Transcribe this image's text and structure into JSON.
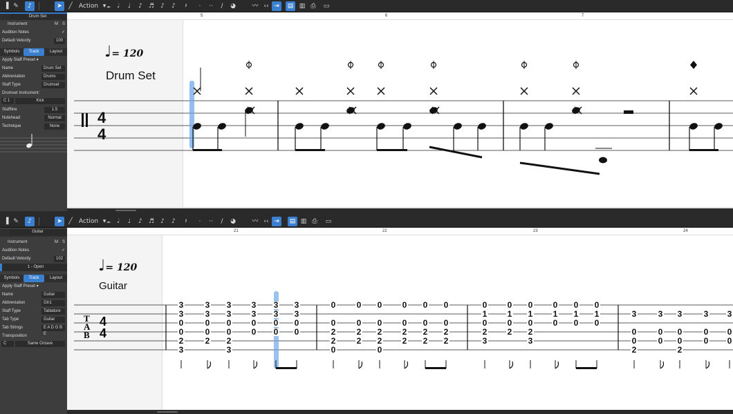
{
  "drum": {
    "toolbar": {
      "action_label": "Action",
      "selected_tool": "pointer-tool"
    },
    "inspector": {
      "track_name": "Drum Set",
      "instrument_label": "Instrument",
      "m_label": "M",
      "s_label": "S",
      "audition_label": "Audition Notes",
      "velocity_label": "Default Velocity",
      "velocity_value": "100",
      "tabs": [
        "Symbols",
        "Track",
        "Layout"
      ],
      "active_tab": "Track",
      "preset_label": "Apply Staff Preset",
      "fields": [
        [
          "Name",
          "Drum Set"
        ],
        [
          "Abbreviation",
          "Drums"
        ],
        [
          "Staff Type",
          "Drumset"
        ]
      ],
      "drumset_instrument_label": "Drumset Instrument:",
      "pitch_value": "C 1",
      "kit_value": "Kick",
      "fields2": [
        [
          "Staffline",
          "1.5"
        ],
        [
          "Notehead",
          "Normal"
        ],
        [
          "Technique",
          "None"
        ]
      ]
    },
    "score": {
      "tempo": "= 120",
      "track_title": "Drum Set",
      "measures": [
        "5",
        "6",
        "7"
      ]
    }
  },
  "guitar": {
    "toolbar": {
      "action_label": "Action",
      "selected_tool": "pointer-tool"
    },
    "inspector": {
      "track_name": "Guitar",
      "instrument_label": "Instrument",
      "m_label": "M",
      "s_label": "S",
      "audition_label": "Audition Notes",
      "velocity_label": "Default Velocity",
      "velocity_value": "102",
      "tuning_value": "1 - Open",
      "tabs": [
        "Symbols",
        "Track",
        "Layout"
      ],
      "active_tab": "Track",
      "preset_label": "Apply Staff Preset",
      "fields": [
        [
          "Name",
          "Guitar"
        ],
        [
          "Abbreviation",
          "Gtr1"
        ],
        [
          "Staff Type",
          "Tablature"
        ],
        [
          "Tab Type",
          "Guitar"
        ],
        [
          "Tab Strings",
          "E A D G B E"
        ]
      ],
      "transposition_label": "Transposition",
      "transpose_key": "C",
      "transpose_octave": "Same Octave"
    },
    "score": {
      "tempo": "= 120",
      "track_title": "Guitar",
      "measures": [
        "21",
        "22",
        "23",
        "24"
      ],
      "clef": [
        "T",
        "A",
        "B"
      ],
      "time_sig": [
        "4",
        "4"
      ],
      "chords": [
        [
          "3",
          "3",
          "0",
          "0",
          "2",
          "3"
        ],
        [
          "3",
          "3",
          "0",
          "0",
          "2",
          ""
        ],
        [
          "3",
          "3",
          "0",
          "0",
          "2",
          "3"
        ],
        [
          "3",
          "3",
          "0",
          "0",
          "",
          ""
        ],
        [
          "3",
          "3",
          "0",
          "0",
          "",
          ""
        ],
        [
          "3",
          "3",
          "0",
          "0",
          "",
          ""
        ],
        [
          "0",
          "",
          "0",
          "2",
          "2",
          "0"
        ],
        [
          "0",
          "",
          "0",
          "2",
          "2",
          ""
        ],
        [
          "0",
          "",
          "0",
          "2",
          "2",
          "0"
        ],
        [
          "0",
          "",
          "0",
          "2",
          "2",
          ""
        ],
        [
          "0",
          "",
          "0",
          "2",
          "2",
          ""
        ],
        [
          "0",
          "",
          "0",
          "2",
          "2",
          ""
        ],
        [
          "0",
          "1",
          "0",
          "2",
          "3",
          ""
        ],
        [
          "0",
          "1",
          "0",
          "2",
          "",
          ""
        ],
        [
          "0",
          "1",
          "0",
          "2",
          "3",
          ""
        ],
        [
          "0",
          "1",
          "0",
          "",
          "",
          ""
        ],
        [
          "0",
          "1",
          "0",
          "",
          "",
          ""
        ],
        [
          "0",
          "1",
          "0",
          "",
          "",
          ""
        ],
        [
          "",
          "3",
          "",
          "0",
          "0",
          "2"
        ],
        [
          "",
          "3",
          "",
          "0",
          "0",
          ""
        ],
        [
          "",
          "3",
          "",
          "0",
          "0",
          "2"
        ],
        [
          "",
          "3",
          "",
          "0",
          "0",
          ""
        ],
        [
          "",
          "3",
          "",
          "0",
          "0",
          ""
        ]
      ]
    }
  }
}
